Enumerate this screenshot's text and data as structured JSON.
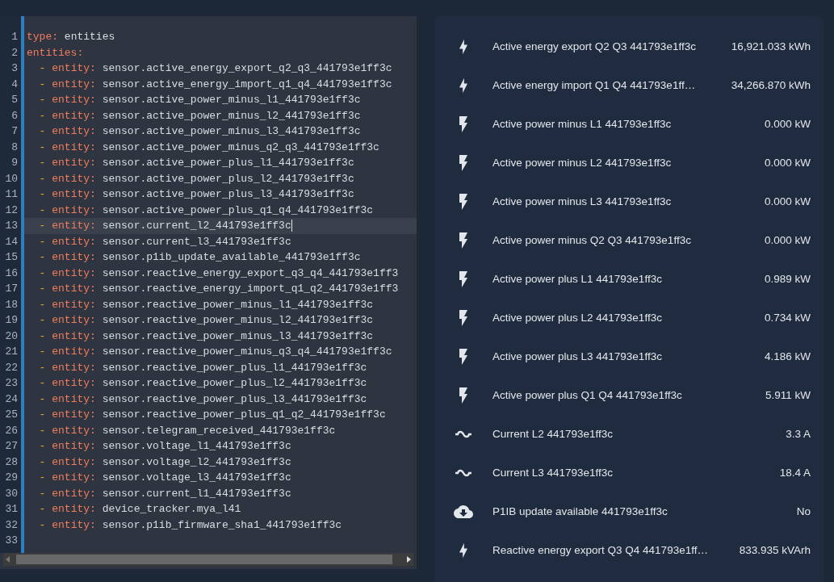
{
  "editor": {
    "lines": [
      {
        "number": "1",
        "kind": "pair",
        "key": "type:",
        "value": "entities",
        "current": false
      },
      {
        "number": "2",
        "kind": "section",
        "key": "entities:",
        "current": false
      },
      {
        "number": "3",
        "kind": "item",
        "dash": "-",
        "key": "entity:",
        "value": "sensor.active_energy_export_q2_q3_441793e1ff3c",
        "current": false
      },
      {
        "number": "4",
        "kind": "item",
        "dash": "-",
        "key": "entity:",
        "value": "sensor.active_energy_import_q1_q4_441793e1ff3c",
        "current": false
      },
      {
        "number": "5",
        "kind": "item",
        "dash": "-",
        "key": "entity:",
        "value": "sensor.active_power_minus_l1_441793e1ff3c",
        "current": false
      },
      {
        "number": "6",
        "kind": "item",
        "dash": "-",
        "key": "entity:",
        "value": "sensor.active_power_minus_l2_441793e1ff3c",
        "current": false
      },
      {
        "number": "7",
        "kind": "item",
        "dash": "-",
        "key": "entity:",
        "value": "sensor.active_power_minus_l3_441793e1ff3c",
        "current": false
      },
      {
        "number": "8",
        "kind": "item",
        "dash": "-",
        "key": "entity:",
        "value": "sensor.active_power_minus_q2_q3_441793e1ff3c",
        "current": false
      },
      {
        "number": "9",
        "kind": "item",
        "dash": "-",
        "key": "entity:",
        "value": "sensor.active_power_plus_l1_441793e1ff3c",
        "current": false
      },
      {
        "number": "10",
        "kind": "item",
        "dash": "-",
        "key": "entity:",
        "value": "sensor.active_power_plus_l2_441793e1ff3c",
        "current": false
      },
      {
        "number": "11",
        "kind": "item",
        "dash": "-",
        "key": "entity:",
        "value": "sensor.active_power_plus_l3_441793e1ff3c",
        "current": false
      },
      {
        "number": "12",
        "kind": "item",
        "dash": "-",
        "key": "entity:",
        "value": "sensor.active_power_plus_q1_q4_441793e1ff3c",
        "current": false
      },
      {
        "number": "13",
        "kind": "item",
        "dash": "-",
        "key": "entity:",
        "value": "sensor.current_l2_441793e1ff3c",
        "current": true
      },
      {
        "number": "14",
        "kind": "item",
        "dash": "-",
        "key": "entity:",
        "value": "sensor.current_l3_441793e1ff3c",
        "current": false
      },
      {
        "number": "15",
        "kind": "item",
        "dash": "-",
        "key": "entity:",
        "value": "sensor.p1ib_update_available_441793e1ff3c",
        "current": false
      },
      {
        "number": "16",
        "kind": "item",
        "dash": "-",
        "key": "entity:",
        "value": "sensor.reactive_energy_export_q3_q4_441793e1ff3",
        "current": false
      },
      {
        "number": "17",
        "kind": "item",
        "dash": "-",
        "key": "entity:",
        "value": "sensor.reactive_energy_import_q1_q2_441793e1ff3",
        "current": false
      },
      {
        "number": "18",
        "kind": "item",
        "dash": "-",
        "key": "entity:",
        "value": "sensor.reactive_power_minus_l1_441793e1ff3c",
        "current": false
      },
      {
        "number": "19",
        "kind": "item",
        "dash": "-",
        "key": "entity:",
        "value": "sensor.reactive_power_minus_l2_441793e1ff3c",
        "current": false
      },
      {
        "number": "20",
        "kind": "item",
        "dash": "-",
        "key": "entity:",
        "value": "sensor.reactive_power_minus_l3_441793e1ff3c",
        "current": false
      },
      {
        "number": "21",
        "kind": "item",
        "dash": "-",
        "key": "entity:",
        "value": "sensor.reactive_power_minus_q3_q4_441793e1ff3c",
        "current": false
      },
      {
        "number": "22",
        "kind": "item",
        "dash": "-",
        "key": "entity:",
        "value": "sensor.reactive_power_plus_l1_441793e1ff3c",
        "current": false
      },
      {
        "number": "23",
        "kind": "item",
        "dash": "-",
        "key": "entity:",
        "value": "sensor.reactive_power_plus_l2_441793e1ff3c",
        "current": false
      },
      {
        "number": "24",
        "kind": "item",
        "dash": "-",
        "key": "entity:",
        "value": "sensor.reactive_power_plus_l3_441793e1ff3c",
        "current": false
      },
      {
        "number": "25",
        "kind": "item",
        "dash": "-",
        "key": "entity:",
        "value": "sensor.reactive_power_plus_q1_q2_441793e1ff3c",
        "current": false
      },
      {
        "number": "26",
        "kind": "item",
        "dash": "-",
        "key": "entity:",
        "value": "sensor.telegram_received_441793e1ff3c",
        "current": false
      },
      {
        "number": "27",
        "kind": "item",
        "dash": "-",
        "key": "entity:",
        "value": "sensor.voltage_l1_441793e1ff3c",
        "current": false
      },
      {
        "number": "28",
        "kind": "item",
        "dash": "-",
        "key": "entity:",
        "value": "sensor.voltage_l2_441793e1ff3c",
        "current": false
      },
      {
        "number": "29",
        "kind": "item",
        "dash": "-",
        "key": "entity:",
        "value": "sensor.voltage_l3_441793e1ff3c",
        "current": false
      },
      {
        "number": "30",
        "kind": "item",
        "dash": "-",
        "key": "entity:",
        "value": "sensor.current_l1_441793e1ff3c",
        "current": false
      },
      {
        "number": "31",
        "kind": "item",
        "dash": "-",
        "key": "entity:",
        "value": "device_tracker.mya_l41",
        "current": false
      },
      {
        "number": "32",
        "kind": "item",
        "dash": "-",
        "key": "entity:",
        "value": "sensor.p1ib_firmware_sha1_441793e1ff3c",
        "current": false
      },
      {
        "number": "33",
        "kind": "empty",
        "current": false
      }
    ]
  },
  "entities_card": {
    "rows": [
      {
        "kind": "energy",
        "label": "Active energy export Q2 Q3 441793e1ff3c",
        "value": "16,921.033 kWh"
      },
      {
        "kind": "energy",
        "label": "Active energy import Q1 Q4 441793e1ff…",
        "value": "34,266.870 kWh"
      },
      {
        "kind": "power",
        "label": "Active power minus L1 441793e1ff3c",
        "value": "0.000 kW"
      },
      {
        "kind": "power",
        "label": "Active power minus L2 441793e1ff3c",
        "value": "0.000 kW"
      },
      {
        "kind": "power",
        "label": "Active power minus L3 441793e1ff3c",
        "value": "0.000 kW"
      },
      {
        "kind": "power",
        "label": "Active power minus Q2 Q3 441793e1ff3c",
        "value": "0.000 kW"
      },
      {
        "kind": "power",
        "label": "Active power plus L1 441793e1ff3c",
        "value": "0.989 kW"
      },
      {
        "kind": "power",
        "label": "Active power plus L2 441793e1ff3c",
        "value": "0.734 kW"
      },
      {
        "kind": "power",
        "label": "Active power plus L3 441793e1ff3c",
        "value": "4.186 kW"
      },
      {
        "kind": "power",
        "label": "Active power plus Q1 Q4 441793e1ff3c",
        "value": "5.911 kW"
      },
      {
        "kind": "current",
        "label": "Current L2 441793e1ff3c",
        "value": "3.3 A"
      },
      {
        "kind": "current",
        "label": "Current L3 441793e1ff3c",
        "value": "18.4 A"
      },
      {
        "kind": "update",
        "label": "P1IB update available 441793e1ff3c",
        "value": "No"
      },
      {
        "kind": "energy",
        "label": "Reactive energy export Q3 Q4 441793e1ff…",
        "value": "833.935 kVArh"
      }
    ]
  }
}
